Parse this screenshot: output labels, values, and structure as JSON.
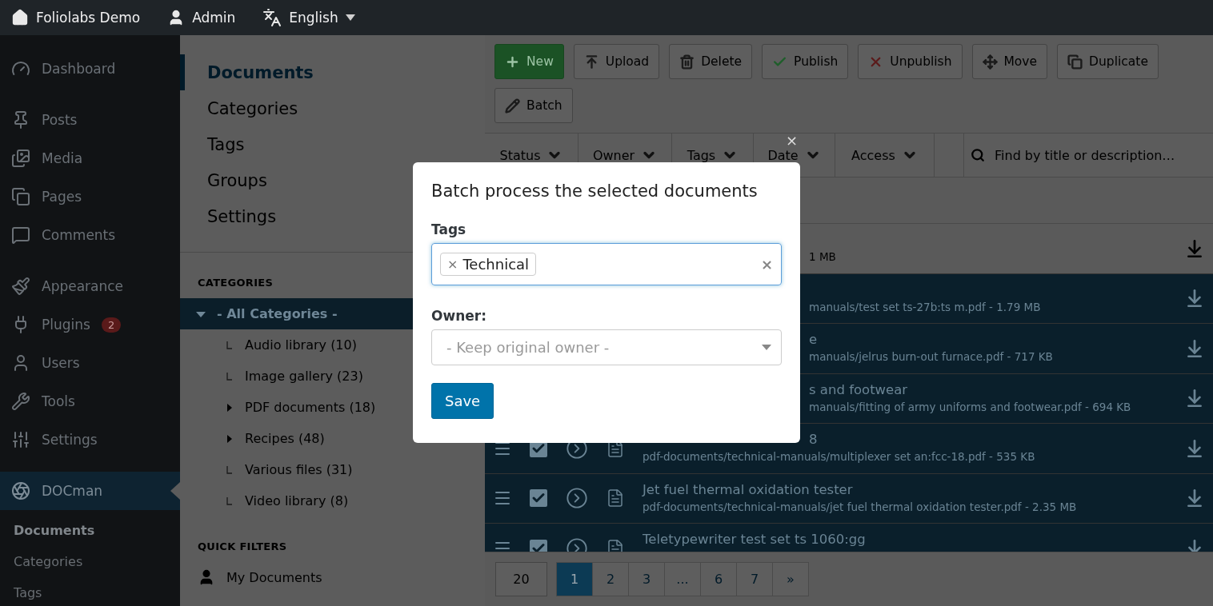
{
  "top_bar": {
    "site": "Foliolabs Demo",
    "user": "Admin",
    "language": "English"
  },
  "admin_menu": [
    {
      "label": "Dashboard",
      "selected": false
    },
    {
      "label": "Posts",
      "selected": false
    },
    {
      "label": "Media",
      "selected": false
    },
    {
      "label": "Pages",
      "selected": false
    },
    {
      "label": "Comments",
      "selected": false
    },
    {
      "label": "Appearance",
      "selected": false
    },
    {
      "label": "Plugins",
      "selected": false,
      "badge": "2"
    },
    {
      "label": "Users",
      "selected": false
    },
    {
      "label": "Tools",
      "selected": false
    },
    {
      "label": "Settings",
      "selected": false
    },
    {
      "label": "DOCman",
      "selected": true
    }
  ],
  "admin_submenu": [
    {
      "label": "Documents",
      "selected": true
    },
    {
      "label": "Categories",
      "selected": false
    },
    {
      "label": "Tags",
      "selected": false
    }
  ],
  "section_nav": [
    {
      "label": "Documents",
      "selected": true
    },
    {
      "label": "Categories",
      "selected": false
    },
    {
      "label": "Tags",
      "selected": false
    },
    {
      "label": "Groups",
      "selected": false
    },
    {
      "label": "Settings",
      "selected": false
    }
  ],
  "categories": {
    "heading": "CATEGORIES",
    "tree": [
      {
        "label": "- All Categories -",
        "selected": true,
        "kind": "folder",
        "expanded": true,
        "children": [
          {
            "label": "Audio library (10)",
            "selected": false,
            "kind": "leaf"
          },
          {
            "label": "Image gallery (23)",
            "selected": false,
            "kind": "leaf"
          },
          {
            "label": "PDF documents (18)",
            "selected": false,
            "kind": "folder",
            "expanded": false
          },
          {
            "label": "Recipes (48)",
            "selected": false,
            "kind": "folder",
            "expanded": false
          },
          {
            "label": "Various files (31)",
            "selected": false,
            "kind": "leaf"
          },
          {
            "label": "Video library (8)",
            "selected": false,
            "kind": "leaf"
          }
        ]
      }
    ]
  },
  "quick_filters": {
    "heading": "QUICK FILTERS",
    "items": [
      {
        "label": "My Documents"
      }
    ]
  },
  "toolbar": [
    {
      "label": "New",
      "kind": "primary"
    },
    {
      "label": "Upload",
      "kind": "default"
    },
    {
      "label": "Delete",
      "kind": "default"
    },
    {
      "label": "Publish",
      "kind": "default"
    },
    {
      "label": "Unpublish",
      "kind": "default"
    },
    {
      "label": "Move",
      "kind": "default"
    },
    {
      "label": "Duplicate",
      "kind": "default"
    },
    {
      "label": "Batch",
      "kind": "default"
    }
  ],
  "filters": [
    "Status",
    "Owner",
    "Tags",
    "Date",
    "Access"
  ],
  "search": {
    "placeholder": "Find by title or description…"
  },
  "rows": [
    {
      "kind": "covered",
      "selected": false,
      "path": "1 MB"
    },
    {
      "kind": "covered",
      "selected": true,
      "path": "manuals/test set ts-27b:ts m.pdf - 1.79 MB"
    },
    {
      "kind": "covered",
      "selected": true,
      "title": "e",
      "path": "manuals/jelrus burn-out furnace.pdf - 717 KB"
    },
    {
      "kind": "covered",
      "selected": true,
      "title": "s and footwear",
      "path": "manuals/fitting of army uniforms and footwear.pdf - 694 KB"
    },
    {
      "kind": "partial",
      "selected": true,
      "checked": true,
      "title": "8",
      "path": "pdf-documents/technical-manuals/multiplexer set an:fcc-18.pdf - 535 KB"
    },
    {
      "kind": "full",
      "selected": true,
      "checked": true,
      "title": "Jet fuel thermal oxidation tester",
      "path": "pdf-documents/technical-manuals/jet fuel thermal oxidation tester.pdf - 2.35 MB"
    },
    {
      "kind": "full",
      "selected": true,
      "checked": true,
      "title": "Teletypewriter test set ts 1060:gg"
    }
  ],
  "pagination": {
    "page_size": "20",
    "pages": [
      {
        "label": "1",
        "selected": true
      },
      {
        "label": "2",
        "selected": false
      },
      {
        "label": "3",
        "selected": false
      },
      {
        "label": "...",
        "selected": false
      },
      {
        "label": "6",
        "selected": false
      },
      {
        "label": "7",
        "selected": false
      },
      {
        "label": "»",
        "selected": false
      }
    ]
  },
  "modal": {
    "title": "Batch process the selected documents",
    "close": "×",
    "tags_label": "Tags",
    "tags": [
      {
        "label": "Technical",
        "remove": "×"
      }
    ],
    "clear": "×",
    "owner_label": "Owner:",
    "owner_placeholder": "- Keep original owner -",
    "save": "Save"
  }
}
